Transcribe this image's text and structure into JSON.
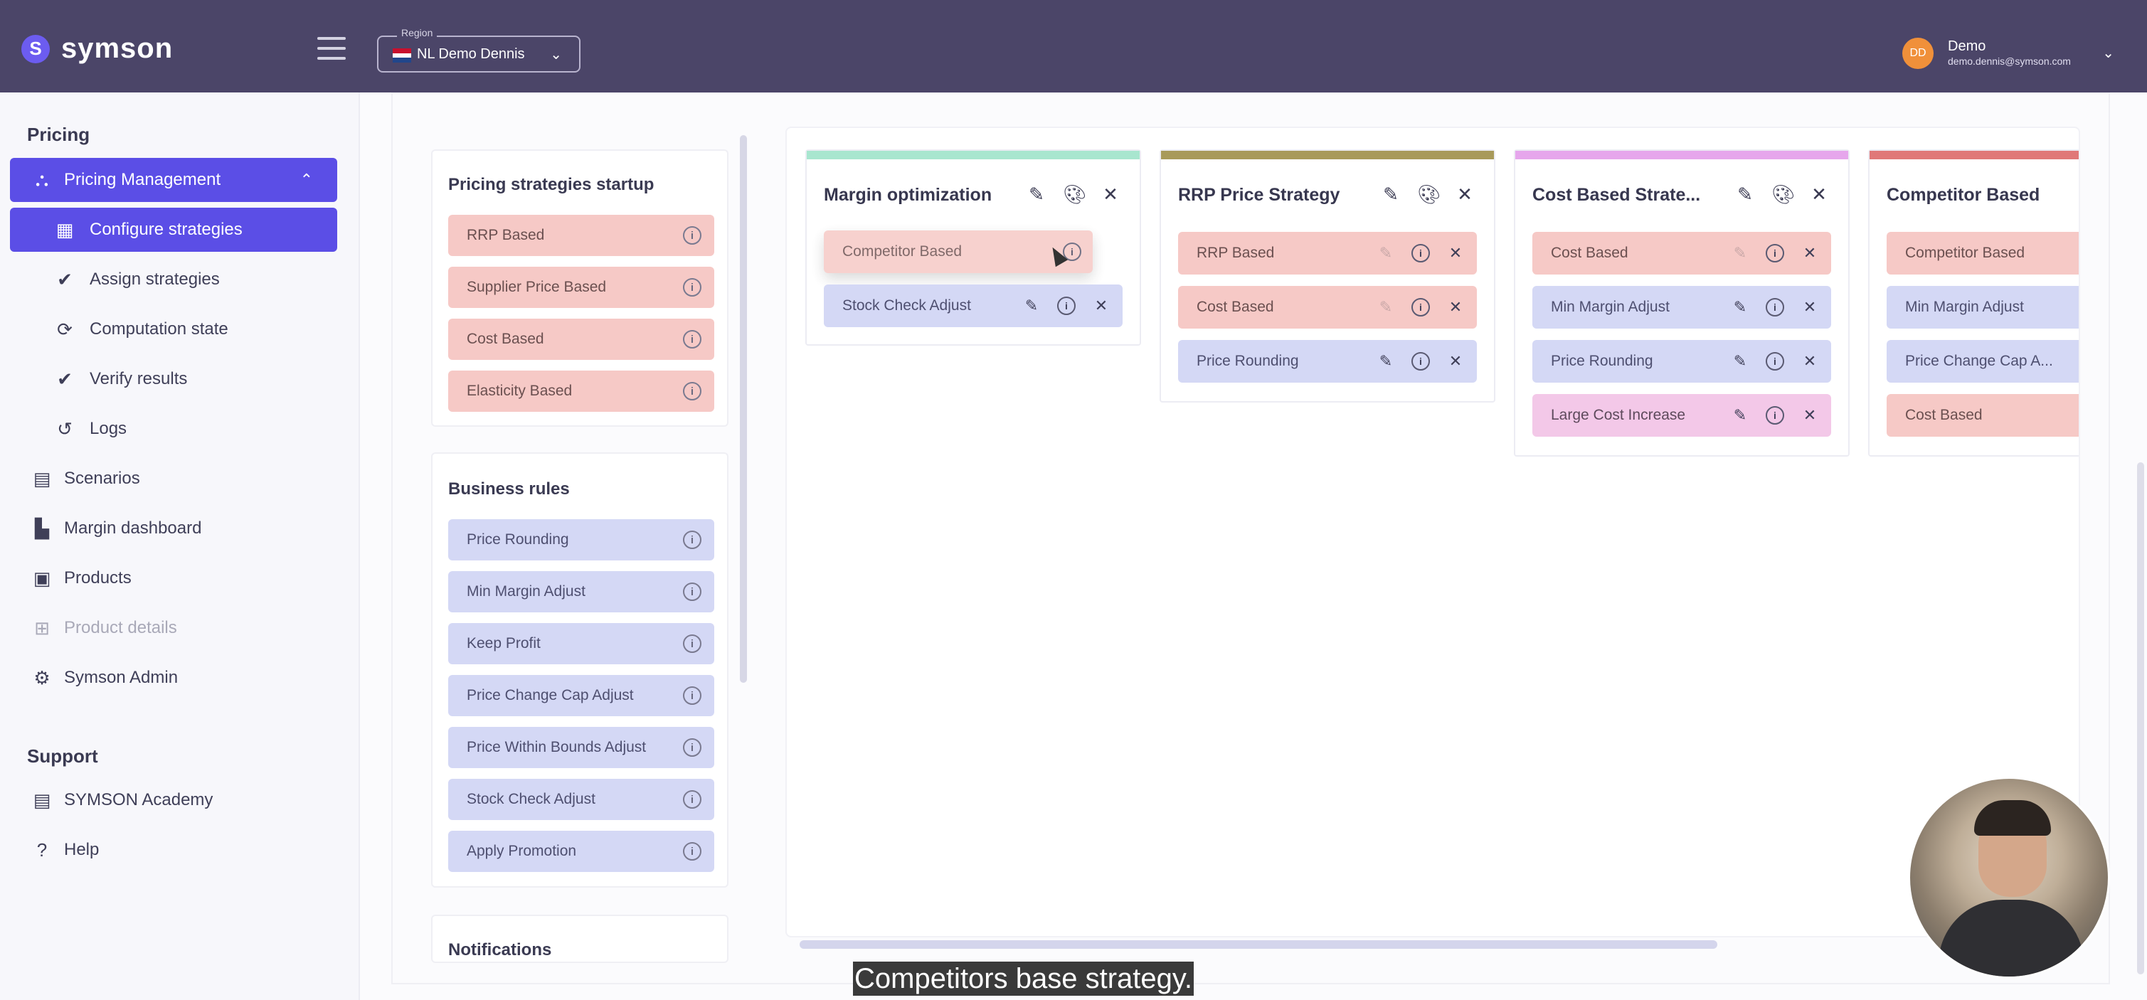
{
  "app": {
    "brand_mark": "S",
    "brand_name": "symson"
  },
  "region": {
    "label": "Region",
    "value": "NL Demo Dennis",
    "flag_colors": [
      "#c8102e",
      "#ffffff",
      "#21468b"
    ]
  },
  "user": {
    "initials": "DD",
    "name": "Demo",
    "email": "demo.dennis@symson.com"
  },
  "sidebar": {
    "section_pricing": "Pricing",
    "items": [
      {
        "label": "Pricing Management",
        "icon": "sitemap-icon",
        "glyph": "⛬"
      },
      {
        "label": "Configure strategies",
        "icon": "grid-icon",
        "glyph": "▦"
      },
      {
        "label": "Assign strategies",
        "icon": "double-check-icon",
        "glyph": "✔"
      },
      {
        "label": "Computation state",
        "icon": "refresh-icon",
        "glyph": "⟳"
      },
      {
        "label": "Verify results",
        "icon": "double-check-icon",
        "glyph": "✔"
      },
      {
        "label": "Logs",
        "icon": "history-icon",
        "glyph": "↺"
      },
      {
        "label": "Scenarios",
        "icon": "book-icon",
        "glyph": "▤"
      },
      {
        "label": "Margin dashboard",
        "icon": "dashboard-icon",
        "glyph": "▙"
      },
      {
        "label": "Products",
        "icon": "clipboard-icon",
        "glyph": "▣"
      },
      {
        "label": "Product details",
        "icon": "table-icon",
        "glyph": "⊞"
      },
      {
        "label": "Symson Admin",
        "icon": "admin-gear-icon",
        "glyph": "⚙"
      }
    ],
    "section_support": "Support",
    "support_items": [
      {
        "label": "SYMSON Academy",
        "icon": "book-icon",
        "glyph": "▤"
      },
      {
        "label": "Help",
        "icon": "help-icon",
        "glyph": "?"
      }
    ]
  },
  "palette": {
    "startup_title": "Pricing strategies startup",
    "startup_items": [
      "RRP Based",
      "Supplier Price Based",
      "Cost Based",
      "Elasticity Based"
    ],
    "rules_title": "Business rules",
    "rules_items": [
      "Price Rounding",
      "Min Margin Adjust",
      "Keep Profit",
      "Price Change Cap Adjust",
      "Price Within Bounds Adjust",
      "Stock Check Adjust",
      "Apply Promotion"
    ],
    "notifications_title": "Notifications"
  },
  "board": {
    "columns": [
      {
        "title": "Margin optimization",
        "accent": "#a8e6cf",
        "cards": [
          {
            "label": "Competitor Based",
            "color": "red"
          },
          {
            "label": "Stock Check Adjust",
            "color": "blue"
          }
        ]
      },
      {
        "title": "RRP Price Strategy",
        "accent": "#a89a5a",
        "cards": [
          {
            "label": "RRP Based",
            "color": "red"
          },
          {
            "label": "Cost Based",
            "color": "red"
          },
          {
            "label": "Price Rounding",
            "color": "blue"
          }
        ]
      },
      {
        "title": "Cost Based Strate...",
        "accent": "#e6a6ec",
        "cards": [
          {
            "label": "Cost Based",
            "color": "red"
          },
          {
            "label": "Min Margin Adjust",
            "color": "blue"
          },
          {
            "label": "Price Rounding",
            "color": "blue"
          },
          {
            "label": "Large Cost Increase",
            "color": "pink"
          }
        ]
      },
      {
        "title": "Competitor Based",
        "accent": "#e07878",
        "cards": [
          {
            "label": "Competitor Based",
            "color": "red"
          },
          {
            "label": "Min Margin Adjust",
            "color": "blue"
          },
          {
            "label": "Price Change Cap A...",
            "color": "blue"
          },
          {
            "label": "Cost Based",
            "color": "red"
          }
        ]
      }
    ]
  },
  "caption": "Competitors base strategy."
}
